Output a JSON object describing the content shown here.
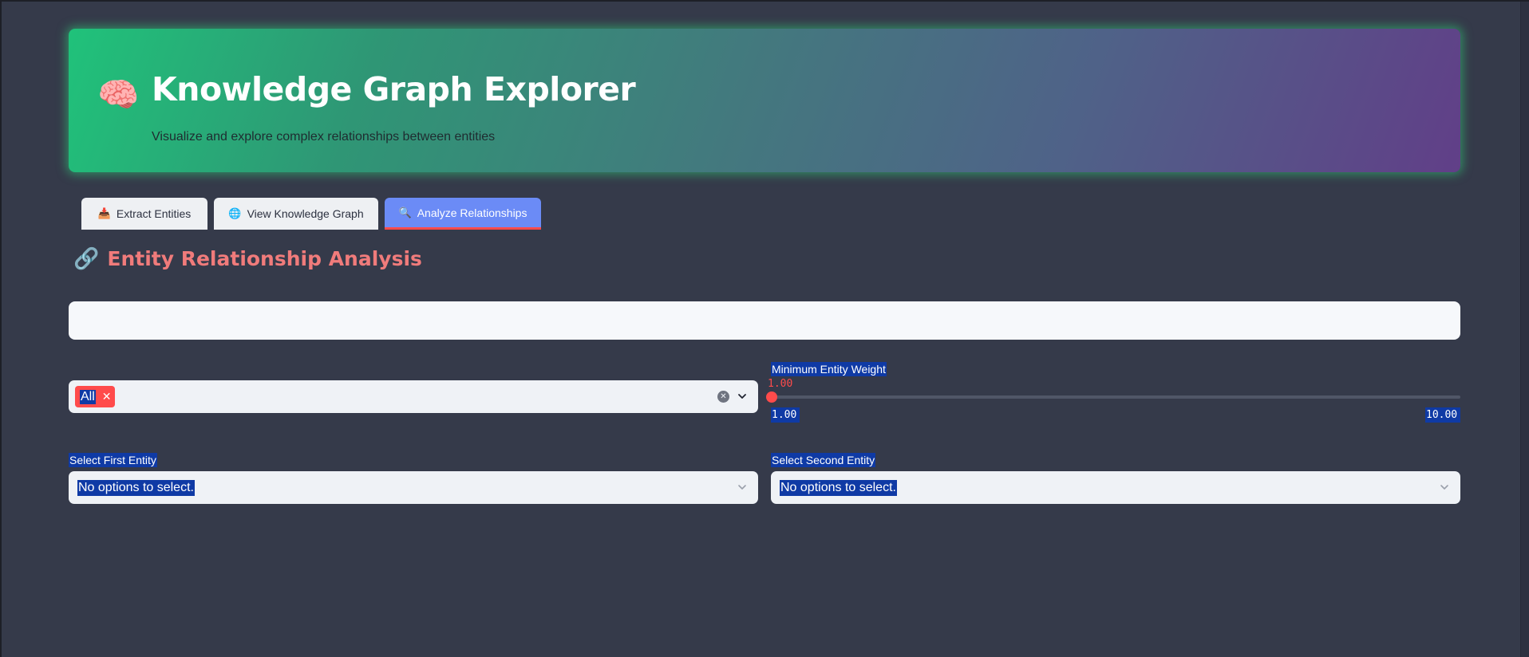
{
  "header": {
    "icon": "brain-icon",
    "icon_glyph": "🧠",
    "title": "Knowledge Graph Explorer",
    "subtitle": "Visualize and explore complex relationships between entities"
  },
  "tabs": [
    {
      "label": "Extract Entities",
      "icon": "inbox-tray-icon",
      "glyph": "📥",
      "active": false
    },
    {
      "label": "View Knowledge Graph",
      "icon": "globe-icon",
      "glyph": "🌐",
      "active": false
    },
    {
      "label": "Analyze Relationships",
      "icon": "magnifier-icon",
      "glyph": "🔍",
      "active": true
    }
  ],
  "section": {
    "icon": "link-icon",
    "icon_glyph": "🔗",
    "heading": "Entity Relationship Analysis"
  },
  "entity_type_filter": {
    "chip_label": "All",
    "remove_glyph": "✕",
    "clear_glyph": "✕"
  },
  "weight_slider": {
    "label": "Minimum Entity Weight",
    "value_text": "1.00",
    "value": 1.0,
    "min": 1.0,
    "max": 10.0,
    "min_text": "1.00",
    "max_text": "10.00"
  },
  "first_entity": {
    "label": "Select First Entity",
    "value": "No options to select."
  },
  "second_entity": {
    "label": "Select Second Entity",
    "value": "No options to select."
  },
  "colors": {
    "accent": "#ff4b4b",
    "tab_active": "#6b8bf6",
    "heading": "#f07b7b",
    "background": "#353a4a",
    "selection_highlight": "#0f3aa5"
  }
}
